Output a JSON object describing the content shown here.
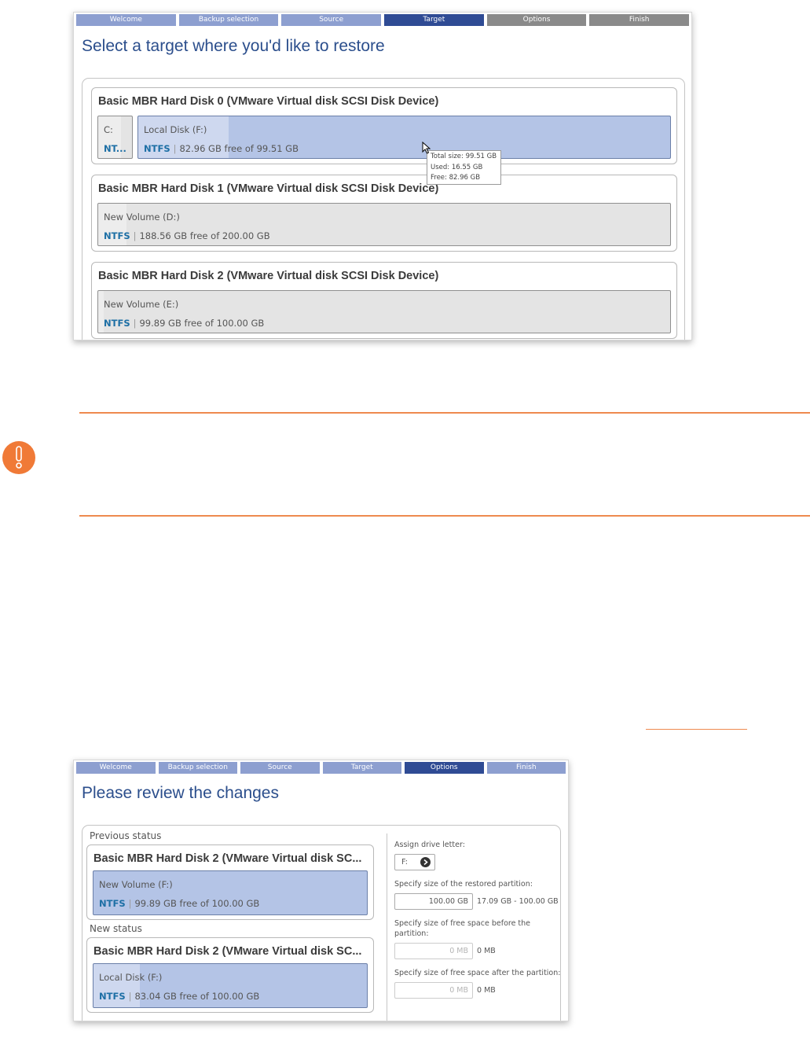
{
  "wizard_steps": [
    "Welcome",
    "Backup selection",
    "Source",
    "Target",
    "Options",
    "Finish"
  ],
  "target_screen": {
    "heading": "Select a target where you'd like to restore",
    "active_step": "Target",
    "disks": [
      {
        "title": "Basic MBR Hard Disk 0 (VMware Virtual disk SCSI Disk Device)",
        "partitions": [
          {
            "name": "C:",
            "fs": "NT...",
            "info": ""
          },
          {
            "name": "Local Disk (F:)",
            "fs": "NTFS",
            "info": "82.96 GB free of 99.51 GB",
            "selected": true
          }
        ]
      },
      {
        "title": "Basic MBR Hard Disk 1 (VMware Virtual disk SCSI Disk Device)",
        "partitions": [
          {
            "name": "New Volume (D:)",
            "fs": "NTFS",
            "info": "188.56 GB free of 200.00 GB"
          }
        ]
      },
      {
        "title": "Basic MBR Hard Disk 2 (VMware Virtual disk SCSI Disk Device)",
        "partitions": [
          {
            "name": "New Volume (E:)",
            "fs": "NTFS",
            "info": "99.89 GB free of 100.00 GB"
          }
        ]
      }
    ],
    "tooltip": {
      "total": "Total size: 99.51 GB",
      "used": "Used: 16.55 GB",
      "free": "Free: 82.96 GB"
    }
  },
  "options_screen": {
    "heading": "Please review the changes",
    "active_step": "Options",
    "previous_status": {
      "label": "Previous status",
      "disk_title": "Basic MBR Hard Disk 2 (VMware Virtual disk SC...",
      "partition_name": "New Volume (F:)",
      "fs": "NTFS",
      "info": "99.89 GB free of 100.00 GB"
    },
    "new_status": {
      "label": "New status",
      "disk_title": "Basic MBR Hard Disk 2 (VMware Virtual disk SC...",
      "partition_name": "Local Disk (F:)",
      "fs": "NTFS",
      "info": "83.04 GB free of 100.00 GB"
    },
    "assign_letter_label": "Assign drive letter:",
    "drive_letter": "F:",
    "size_label": "Specify size of the restored partition:",
    "size_value": "100.00 GB",
    "size_range": "17.09 GB - 100.00 GB",
    "free_before_label_1": "Specify size of free space before the",
    "free_before_label_2": "partition:",
    "free_before_value": "0 MB",
    "free_before_hint": "0 MB",
    "free_after_label": "Specify size of free space after the partition:",
    "free_after_value": "0 MB",
    "free_after_hint": "0 MB"
  }
}
